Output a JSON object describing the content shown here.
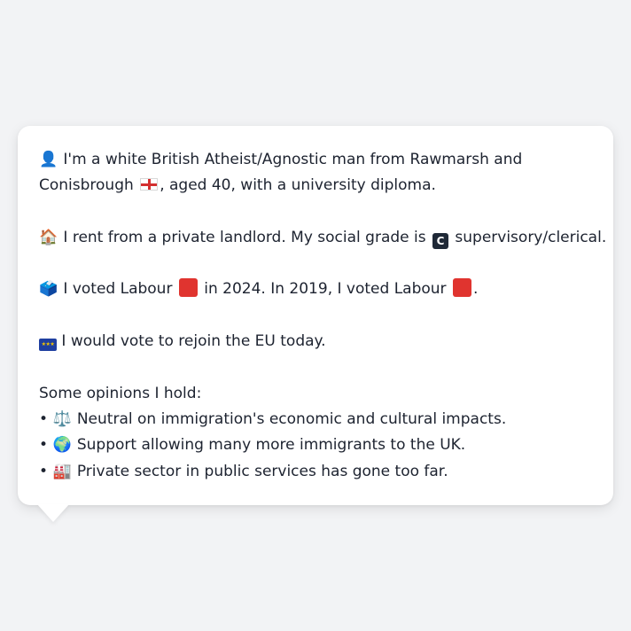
{
  "profile": {
    "line1_icon": "👤",
    "line1_text": "I'm a white British Atheist/Agnostic man from Rawmarsh and",
    "line2_text_a": "Conisbrough",
    "line2_flag": "england-flag",
    "line2_text_b": ", aged 40, with a university diploma.",
    "housing_icon": "🏠",
    "housing_text_a": "I rent from a private landlord. My social grade is",
    "grade_badge": "C",
    "housing_text_b": "supervisory/clerical.",
    "vote_icon": "🗳️",
    "vote_text_a": "I voted Labour",
    "vote_text_b": "in 2024. In 2019, I voted Labour",
    "vote_text_c": ".",
    "labour_color": "#e0342f",
    "eu_icon": "eu-flag",
    "eu_stars": "★★★",
    "eu_text": "I would vote to rejoin the EU today."
  },
  "opinions": {
    "heading": "Some opinions I hold:",
    "bullet": "•",
    "items": [
      {
        "icon": "⚖️",
        "text": "Neutral on immigration's economic and cultural impacts."
      },
      {
        "icon": "🌍",
        "text": "Support allowing many more immigrants to the UK."
      },
      {
        "icon": "🏭",
        "text": "Private sector in public services has gone too far."
      }
    ]
  },
  "colors": {
    "background": "#f2f3f5",
    "bubble": "#ffffff",
    "text": "#1d2330"
  }
}
